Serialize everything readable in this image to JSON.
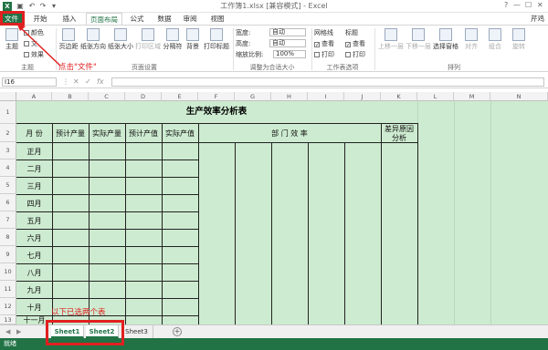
{
  "window": {
    "title": "工作簿1.xlsx [兼容模式] - Excel",
    "controls": [
      "?",
      "—",
      "☐",
      "✕"
    ]
  },
  "ribbon_tabs": [
    "文件",
    "开始",
    "插入",
    "页面布局",
    "公式",
    "数据",
    "审阅",
    "视图"
  ],
  "active_tab": "页面布局",
  "user": "芹鸡",
  "ribbon": {
    "themes": {
      "label": "主题",
      "colors": "颜色",
      "fonts": "文",
      "effects": "效果",
      "group": "主题"
    },
    "page_setup": {
      "buttons": [
        "页边距",
        "纸张方向",
        "纸张大小",
        "打印区域",
        "分隔符",
        "背景",
        "打印标题"
      ],
      "group": "页面设置"
    },
    "scale_to_fit": {
      "width_label": "宽度:",
      "width_value": "自动",
      "height_label": "高度:",
      "height_value": "自动",
      "scale_label": "缩放比例:",
      "scale_value": "100%",
      "group": "调整为合适大小"
    },
    "sheet_options": {
      "gridlines": "网格线",
      "headings": "标题",
      "view": "查看",
      "print": "打印",
      "group": "工作表选项"
    },
    "arrange": {
      "buttons": [
        "上移一层",
        "下移一层",
        "选择窗格",
        "对齐",
        "组合",
        "旋转"
      ],
      "group": "排列"
    }
  },
  "formula_bar": {
    "name_box": "I16",
    "fx": "fx"
  },
  "columns": [
    "A",
    "B",
    "C",
    "D",
    "E",
    "F",
    "G",
    "H",
    "I",
    "J",
    "K",
    "L",
    "M",
    "N"
  ],
  "rows": [
    "1",
    "2",
    "3",
    "4",
    "5",
    "6",
    "7",
    "8",
    "9",
    "10",
    "11",
    "12",
    "13"
  ],
  "table": {
    "title": "生产效率分析表",
    "month_header": "月 份",
    "headers": [
      "预计产量",
      "实际产量",
      "预计产值",
      "实际产值"
    ],
    "dept_header": "部 门 效 率",
    "diff_header_1": "差异原因",
    "diff_header_2": "分析",
    "months": [
      "正月",
      "二月",
      "三月",
      "四月",
      "五月",
      "六月",
      "七月",
      "八月",
      "九月",
      "十月",
      "十一月"
    ]
  },
  "sheets": [
    "Sheet1",
    "Sheet2",
    "Sheet3"
  ],
  "active_sheet": "Sheet2",
  "status": "就绪",
  "annotations": {
    "file_hint": "点击\"文件\"",
    "sheets_hint": "以下已选两个表"
  },
  "colors": {
    "excel_green": "#217346",
    "sheet_fill": "#cdebd0",
    "annotation_red": "#e02020"
  }
}
